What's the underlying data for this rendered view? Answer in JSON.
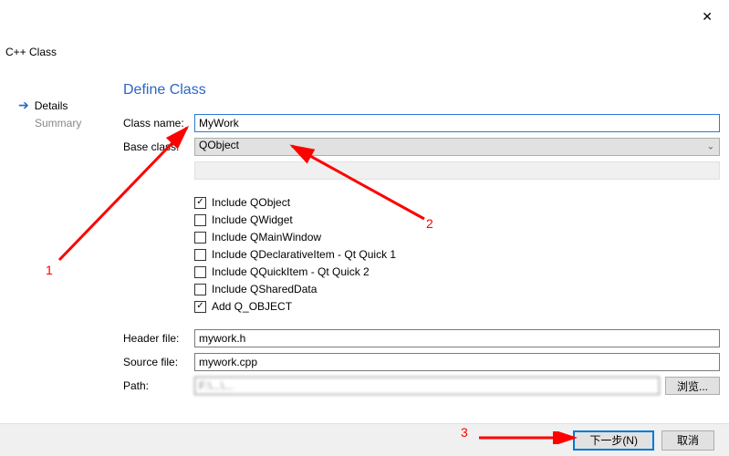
{
  "window": {
    "close_tooltip": "Close"
  },
  "wizard_title": "C++ Class",
  "sidebar": {
    "items": [
      {
        "label": "Details",
        "active": true
      },
      {
        "label": "Summary",
        "active": false
      }
    ]
  },
  "heading": "Define Class",
  "form": {
    "class_name_label": "Class name:",
    "class_name_value": "MyWork",
    "base_class_label": "Base class:",
    "base_class_value": "QObject",
    "header_file_label": "Header file:",
    "header_file_value": "mywork.h",
    "source_file_label": "Source file:",
    "source_file_value": "mywork.cpp",
    "path_label": "Path:",
    "path_value": "F:\\...\\...",
    "browse_label": "浏览..."
  },
  "checkboxes": [
    {
      "label": "Include QObject",
      "checked": true
    },
    {
      "label": "Include QWidget",
      "checked": false
    },
    {
      "label": "Include QMainWindow",
      "checked": false
    },
    {
      "label": "Include QDeclarativeItem - Qt Quick 1",
      "checked": false
    },
    {
      "label": "Include QQuickItem - Qt Quick 2",
      "checked": false
    },
    {
      "label": "Include QSharedData",
      "checked": false
    },
    {
      "label": "Add Q_OBJECT",
      "checked": true
    }
  ],
  "footer": {
    "next_label": "下一步(N)",
    "cancel_label": "取消"
  },
  "annotations": {
    "one": "1",
    "two": "2",
    "three": "3"
  }
}
